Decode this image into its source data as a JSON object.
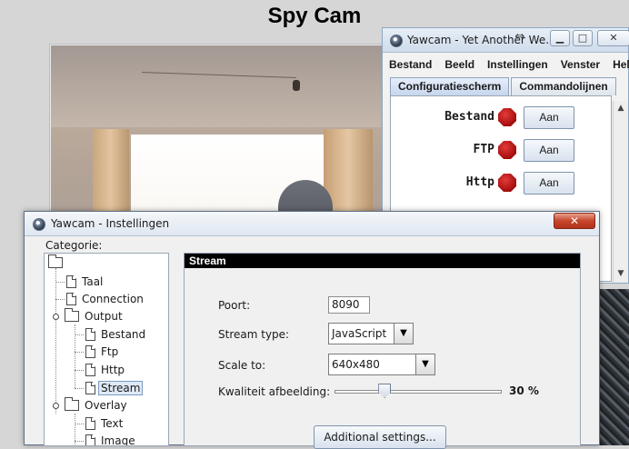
{
  "page": {
    "title": "Spy Cam"
  },
  "main_window": {
    "title": "Yawcam - Yet Another We...",
    "menu": [
      "Bestand",
      "Beeld",
      "Instellingen",
      "Venster",
      "Help"
    ],
    "tabs": [
      "Configuratiescherm",
      "Commandolijnen"
    ],
    "active_tab": 0,
    "services": [
      {
        "label": "Bestand",
        "button": "Aan",
        "status_color": "#c41818"
      },
      {
        "label": "FTP",
        "button": "Aan",
        "status_color": "#c41818"
      },
      {
        "label": "Http",
        "button": "Aan",
        "status_color": "#c41818"
      }
    ]
  },
  "settings_window": {
    "title": "Yawcam - Instellingen",
    "close_glyph": "✕",
    "category_label": "Categorie:",
    "tree": {
      "taal": "Taal",
      "connection": "Connection",
      "output": "Output",
      "bestand": "Bestand",
      "ftp": "Ftp",
      "http": "Http",
      "stream": "Stream",
      "overlay": "Overlay",
      "text": "Text",
      "image": "Image"
    },
    "selected_item": "Stream",
    "stream_panel": {
      "header": "Stream",
      "port_label": "Poort:",
      "port_value": "8090",
      "stream_type_label": "Stream type:",
      "stream_type_value": "JavaScript",
      "scale_label": "Scale to:",
      "scale_value": "640x480",
      "quality_label": "Kwaliteit afbeelding:",
      "quality_value_text": "30 %",
      "quality_fraction": 0.3,
      "additional_button": "Additional settings..."
    }
  },
  "colors": {
    "accent": "#c41818",
    "titlebar": "#dfe7f1",
    "selection": "#dfe9f6"
  }
}
